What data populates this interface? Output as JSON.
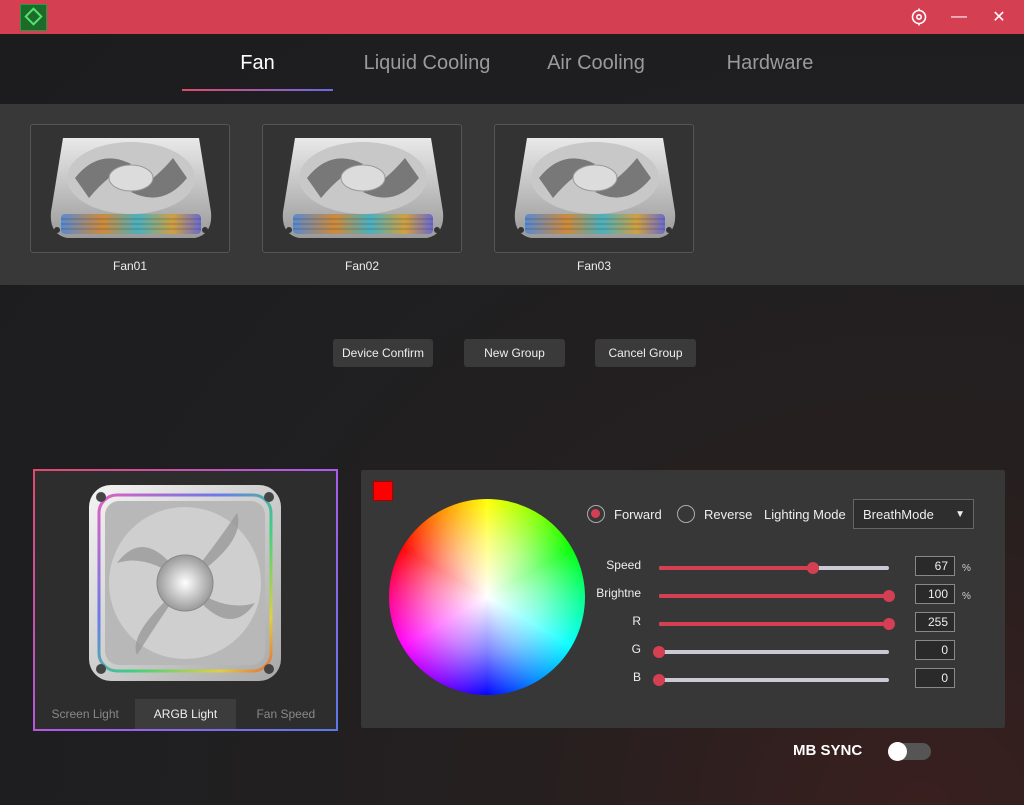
{
  "window": {
    "settings_icon": "settings-icon",
    "minimize_glyph": "—",
    "close_glyph": "✕"
  },
  "nav": {
    "tabs": [
      {
        "label": "Fan",
        "active": true
      },
      {
        "label": "Liquid Cooling",
        "active": false
      },
      {
        "label": "Air Cooling",
        "active": false
      },
      {
        "label": "Hardware",
        "active": false
      }
    ]
  },
  "devices": [
    {
      "label": "Fan01"
    },
    {
      "label": "Fan02"
    },
    {
      "label": "Fan03"
    }
  ],
  "actions": {
    "device_confirm": "Device Confirm",
    "new_group": "New Group",
    "cancel_group": "Cancel Group"
  },
  "preview": {
    "tabs": [
      {
        "label": "Screen Light",
        "active": false
      },
      {
        "label": "ARGB Light",
        "active": true
      },
      {
        "label": "Fan Speed",
        "active": false
      }
    ]
  },
  "lighting": {
    "selected_color": "#ff0000",
    "direction": {
      "forward_label": "Forward",
      "reverse_label": "Reverse",
      "selected": "forward"
    },
    "mode_label": "Lighting Mode",
    "mode_value": "BreathMode",
    "sliders": [
      {
        "label": "Speed",
        "value": "67",
        "fraction": 0.67,
        "unit": "%"
      },
      {
        "label": "Brightne",
        "value": "100",
        "fraction": 1.0,
        "unit": "%"
      },
      {
        "label": "R",
        "value": "255",
        "fraction": 1.0,
        "unit": ""
      },
      {
        "label": "G",
        "value": "0",
        "fraction": 0.0,
        "unit": ""
      },
      {
        "label": "B",
        "value": "0",
        "fraction": 0.0,
        "unit": ""
      }
    ]
  },
  "mb_sync": {
    "label": "MB SYNC",
    "enabled": false
  },
  "colors": {
    "accent": "#d43f52",
    "titlebar": "#d43f52",
    "panel": "#373737"
  }
}
